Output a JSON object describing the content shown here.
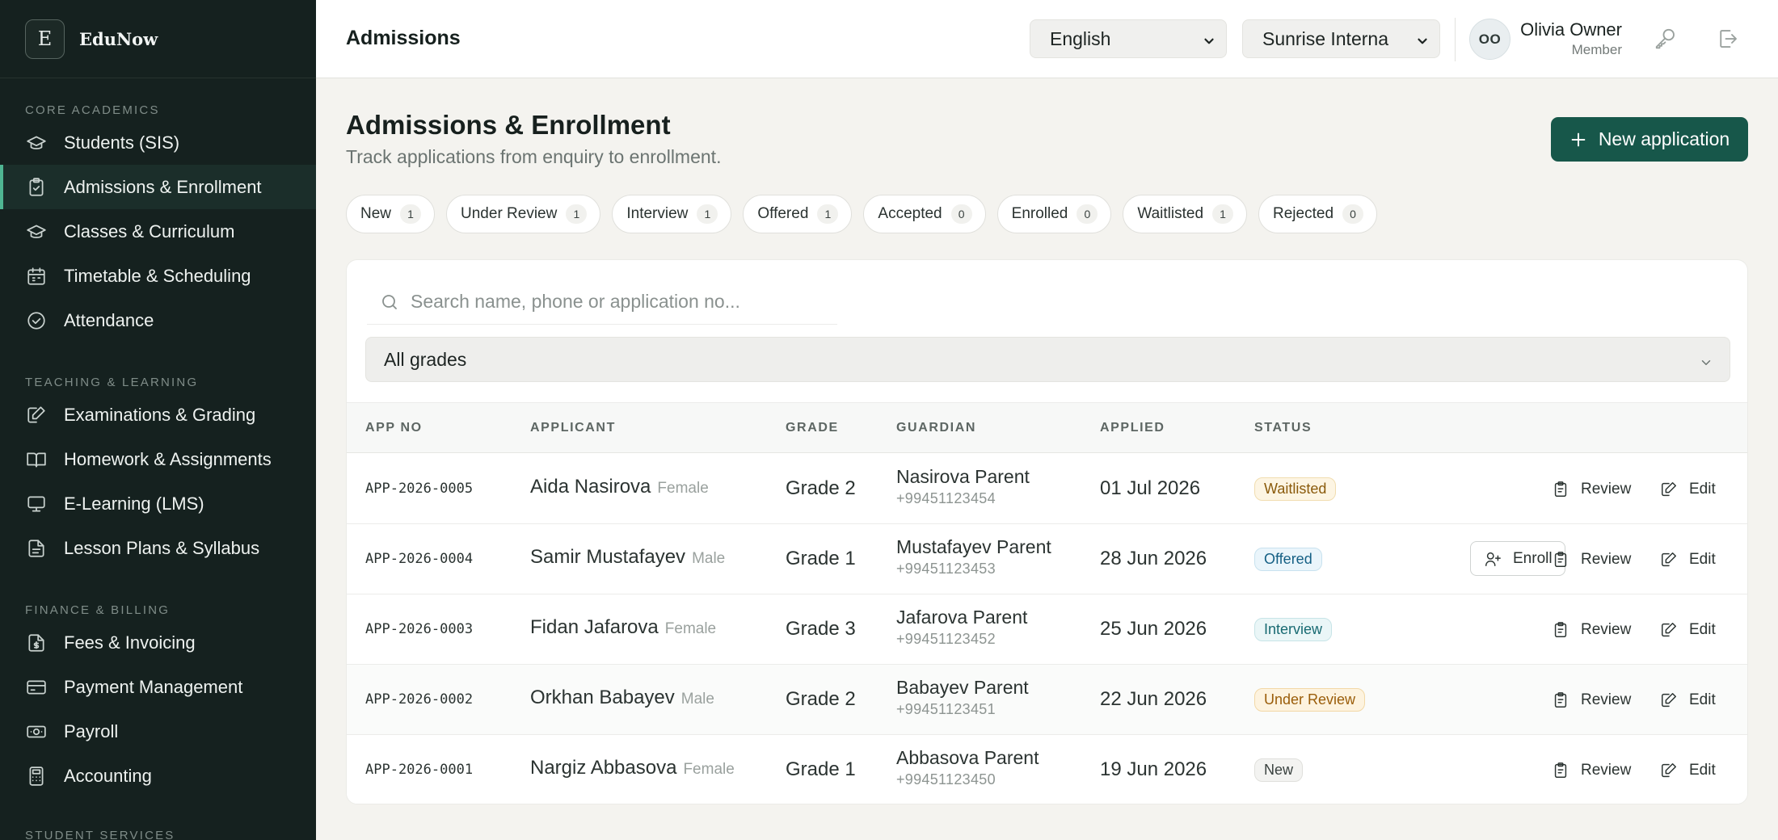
{
  "brand": {
    "logo_letter": "E",
    "name": "EduNow"
  },
  "sidebar": {
    "sections": [
      {
        "heading": "Core Academics",
        "items": [
          {
            "label": "Students (SIS)",
            "icon": "users-icon"
          },
          {
            "label": "Admissions & Enrollment",
            "icon": "clipboard-check-icon",
            "active": true
          },
          {
            "label": "Classes & Curriculum",
            "icon": "graduation-cap-icon"
          },
          {
            "label": "Timetable & Scheduling",
            "icon": "calendar-icon"
          },
          {
            "label": "Attendance",
            "icon": "check-circle-icon"
          }
        ]
      },
      {
        "heading": "Teaching & Learning",
        "items": [
          {
            "label": "Examinations & Grading",
            "icon": "edit-icon"
          },
          {
            "label": "Homework & Assignments",
            "icon": "book-open-icon"
          },
          {
            "label": "E-Learning (LMS)",
            "icon": "monitor-icon"
          },
          {
            "label": "Lesson Plans & Syllabus",
            "icon": "file-text-icon"
          }
        ]
      },
      {
        "heading": "Finance & Billing",
        "items": [
          {
            "label": "Fees & Invoicing",
            "icon": "file-dollar-icon"
          },
          {
            "label": "Payment Management",
            "icon": "credit-card-icon"
          },
          {
            "label": "Payroll",
            "icon": "banknote-icon"
          },
          {
            "label": "Accounting",
            "icon": "calculator-icon"
          }
        ]
      }
    ],
    "cut_heading": "Student Services"
  },
  "topbar": {
    "title": "Admissions",
    "language": "English",
    "school": "Sunrise Interna",
    "avatar_initials": "OO",
    "user_name": "Olivia Owner",
    "user_role": "Member"
  },
  "page": {
    "title": "Admissions & Enrollment",
    "subtitle": "Track applications from enquiry to enrollment.",
    "new_button": "New application"
  },
  "status_chips": [
    {
      "label": "New",
      "count": "1"
    },
    {
      "label": "Under Review",
      "count": "1"
    },
    {
      "label": "Interview",
      "count": "1"
    },
    {
      "label": "Offered",
      "count": "1"
    },
    {
      "label": "Accepted",
      "count": "0"
    },
    {
      "label": "Enrolled",
      "count": "0"
    },
    {
      "label": "Waitlisted",
      "count": "1"
    },
    {
      "label": "Rejected",
      "count": "0"
    }
  ],
  "filters": {
    "search_placeholder": "Search name, phone or application no...",
    "grade": "All grades"
  },
  "table": {
    "headers": {
      "app_no": "APP NO",
      "applicant": "APPLICANT",
      "grade": "GRADE",
      "guardian": "GUARDIAN",
      "applied": "APPLIED",
      "status": "STATUS"
    },
    "actions": {
      "review": "Review",
      "edit": "Edit",
      "enroll": "Enroll"
    },
    "rows": [
      {
        "app_no": "APP-2026-0005",
        "name": "Aida Nasirova",
        "gender": "Female",
        "grade": "Grade 2",
        "guardian": "Nasirova Parent",
        "phone": "+99451123454",
        "applied": "01 Jul 2026",
        "status": "Waitlisted",
        "status_class": "b-waitlisted",
        "enroll": false
      },
      {
        "app_no": "APP-2026-0004",
        "name": "Samir Mustafayev",
        "gender": "Male",
        "grade": "Grade 1",
        "guardian": "Mustafayev Parent",
        "phone": "+99451123453",
        "applied": "28 Jun 2026",
        "status": "Offered",
        "status_class": "b-offered",
        "enroll": true
      },
      {
        "app_no": "APP-2026-0003",
        "name": "Fidan Jafarova",
        "gender": "Female",
        "grade": "Grade 3",
        "guardian": "Jafarova Parent",
        "phone": "+99451123452",
        "applied": "25 Jun 2026",
        "status": "Interview",
        "status_class": "b-interview",
        "enroll": false
      },
      {
        "app_no": "APP-2026-0002",
        "name": "Orkhan Babayev",
        "gender": "Male",
        "grade": "Grade 2",
        "guardian": "Babayev Parent",
        "phone": "+99451123451",
        "applied": "22 Jun 2026",
        "status": "Under Review",
        "status_class": "b-review",
        "enroll": false
      },
      {
        "app_no": "APP-2026-0001",
        "name": "Nargiz Abbasova",
        "gender": "Female",
        "grade": "Grade 1",
        "guardian": "Abbasova Parent",
        "phone": "+99451123450",
        "applied": "19 Jun 2026",
        "status": "New",
        "status_class": "b-new",
        "enroll": false
      }
    ]
  },
  "colors": {
    "sidebar_bg": "#15211f",
    "accent": "#17574a",
    "active_bar": "#4fb592",
    "page_bg": "#f4f3ef"
  }
}
